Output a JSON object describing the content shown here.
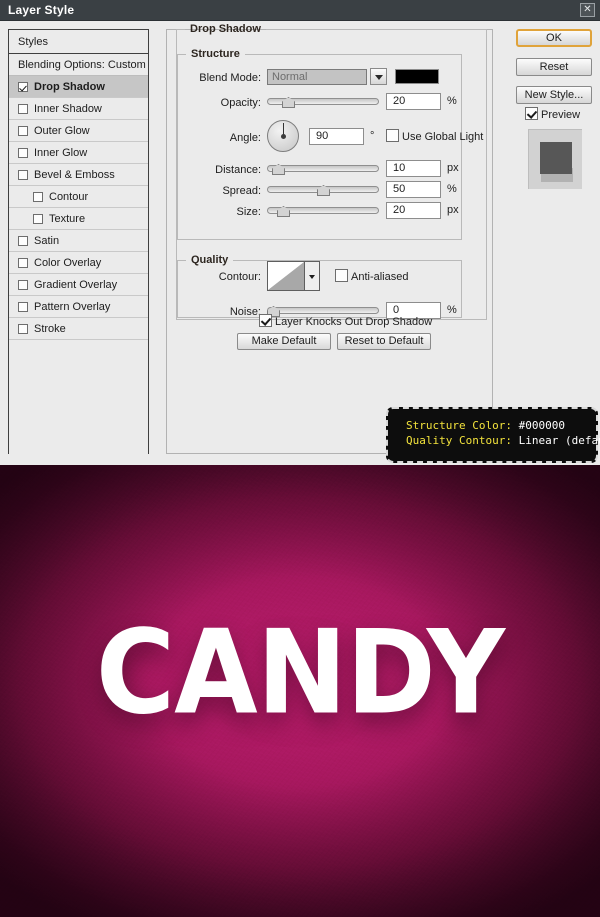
{
  "window": {
    "title": "Layer Style",
    "close_icon": "close-icon"
  },
  "styles_panel": {
    "header": "Styles",
    "blending_options": "Blending Options: Custom",
    "items": [
      {
        "label": "Drop Shadow",
        "checked": true,
        "selected": true,
        "indent": false
      },
      {
        "label": "Inner Shadow",
        "checked": false,
        "selected": false,
        "indent": false
      },
      {
        "label": "Outer Glow",
        "checked": false,
        "selected": false,
        "indent": false
      },
      {
        "label": "Inner Glow",
        "checked": false,
        "selected": false,
        "indent": false
      },
      {
        "label": "Bevel & Emboss",
        "checked": false,
        "selected": false,
        "indent": false
      },
      {
        "label": "Contour",
        "checked": false,
        "selected": false,
        "indent": true
      },
      {
        "label": "Texture",
        "checked": false,
        "selected": false,
        "indent": true
      },
      {
        "label": "Satin",
        "checked": false,
        "selected": false,
        "indent": false
      },
      {
        "label": "Color Overlay",
        "checked": false,
        "selected": false,
        "indent": false
      },
      {
        "label": "Gradient Overlay",
        "checked": false,
        "selected": false,
        "indent": false
      },
      {
        "label": "Pattern Overlay",
        "checked": false,
        "selected": false,
        "indent": false
      },
      {
        "label": "Stroke",
        "checked": false,
        "selected": false,
        "indent": false
      }
    ]
  },
  "settings": {
    "drop_shadow_legend": "Drop Shadow",
    "structure": {
      "legend": "Structure",
      "blend_mode_label": "Blend Mode:",
      "blend_mode_value": "Normal",
      "shadow_color": "#000000",
      "opacity_label": "Opacity:",
      "opacity_value": "20",
      "opacity_unit": "%",
      "angle_label": "Angle:",
      "angle_value": "90",
      "angle_unit": "°",
      "use_global_light_label": "Use Global Light",
      "use_global_light_checked": false,
      "distance_label": "Distance:",
      "distance_value": "10",
      "distance_unit": "px",
      "spread_label": "Spread:",
      "spread_value": "50",
      "spread_unit": "%",
      "size_label": "Size:",
      "size_value": "20",
      "size_unit": "px"
    },
    "quality": {
      "legend": "Quality",
      "contour_label": "Contour:",
      "contour_value": "Linear",
      "anti_aliased_label": "Anti-aliased",
      "anti_aliased_checked": false,
      "noise_label": "Noise:",
      "noise_value": "0",
      "noise_unit": "%"
    },
    "knockout_label": "Layer Knocks Out Drop Shadow",
    "knockout_checked": true,
    "make_default_label": "Make Default",
    "reset_default_label": "Reset to Default"
  },
  "actions": {
    "ok_label": "OK",
    "reset_label": "Reset",
    "new_style_label": "New Style...",
    "preview_label": "Preview",
    "preview_checked": true
  },
  "tooltip": {
    "line1_key": "Structure Color:",
    "line1_value": "#000000",
    "line2_key": "Quality Contour:",
    "line2_value": "Linear (default)"
  },
  "artwork": {
    "text": "CANDY",
    "text_color": "#ffffff",
    "background_center_color": "#a8185f",
    "background_edge_color": "#3d0722"
  }
}
